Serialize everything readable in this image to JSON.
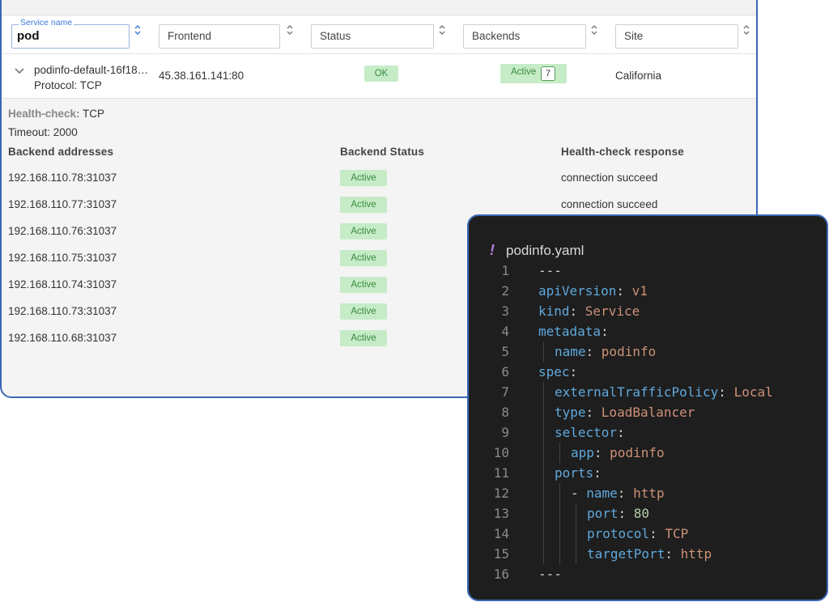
{
  "filters": {
    "service_name_label": "Service name",
    "service_name_value": "pod",
    "frontend_label": "Frontend",
    "status_label": "Status",
    "backends_label": "Backends",
    "site_label": "Site"
  },
  "service_row": {
    "name": "podinfo-default-16f18…",
    "protocol": "Protocol: TCP",
    "frontend": "45.38.161.141:80",
    "status": "OK",
    "backends_label": "Active",
    "backends_count": "7",
    "site": "California"
  },
  "details": {
    "healthcheck_key": "Health-check:",
    "healthcheck_value": "TCP",
    "timeout": "Timeout: 2000",
    "col_addresses": "Backend addresses",
    "col_status": "Backend Status",
    "col_response": "Health-check response",
    "backends": [
      {
        "address": "192.168.110.78:31037",
        "status": "Active",
        "response": "connection succeed"
      },
      {
        "address": "192.168.110.77:31037",
        "status": "Active",
        "response": "connection succeed"
      },
      {
        "address": "192.168.110.76:31037",
        "status": "Active",
        "response": ""
      },
      {
        "address": "192.168.110.75:31037",
        "status": "Active",
        "response": ""
      },
      {
        "address": "192.168.110.74:31037",
        "status": "Active",
        "response": ""
      },
      {
        "address": "192.168.110.73:31037",
        "status": "Active",
        "response": ""
      },
      {
        "address": "192.168.110.68:31037",
        "status": "Active",
        "response": ""
      }
    ]
  },
  "editor": {
    "file_icon": "!",
    "file_name": "podinfo.yaml",
    "lines": [
      {
        "n": "1",
        "indent": 0,
        "key": "",
        "sep": "",
        "value": "---",
        "vtype": "punc"
      },
      {
        "n": "2",
        "indent": 0,
        "key": "apiVersion",
        "sep": ": ",
        "value": "v1",
        "vtype": "val"
      },
      {
        "n": "3",
        "indent": 0,
        "key": "kind",
        "sep": ": ",
        "value": "Service",
        "vtype": "val"
      },
      {
        "n": "4",
        "indent": 0,
        "key": "metadata",
        "sep": ":",
        "value": "",
        "vtype": "val"
      },
      {
        "n": "5",
        "indent": 1,
        "key": "name",
        "sep": ": ",
        "value": "podinfo",
        "vtype": "val"
      },
      {
        "n": "6",
        "indent": 0,
        "key": "spec",
        "sep": ":",
        "value": "",
        "vtype": "val"
      },
      {
        "n": "7",
        "indent": 1,
        "key": "externalTrafficPolicy",
        "sep": ": ",
        "value": "Local",
        "vtype": "val"
      },
      {
        "n": "8",
        "indent": 1,
        "key": "type",
        "sep": ": ",
        "value": "LoadBalancer",
        "vtype": "val"
      },
      {
        "n": "9",
        "indent": 1,
        "key": "selector",
        "sep": ":",
        "value": "",
        "vtype": "val"
      },
      {
        "n": "10",
        "indent": 2,
        "key": "app",
        "sep": ": ",
        "value": "podinfo",
        "vtype": "val"
      },
      {
        "n": "11",
        "indent": 1,
        "key": "ports",
        "sep": ":",
        "value": "",
        "vtype": "val"
      },
      {
        "n": "12",
        "indent": 2,
        "key": "name",
        "sep": ": ",
        "value": "http",
        "vtype": "val",
        "dash": true
      },
      {
        "n": "13",
        "indent": 3,
        "key": "port",
        "sep": ": ",
        "value": "80",
        "vtype": "num"
      },
      {
        "n": "14",
        "indent": 3,
        "key": "protocol",
        "sep": ": ",
        "value": "TCP",
        "vtype": "val"
      },
      {
        "n": "15",
        "indent": 3,
        "key": "targetPort",
        "sep": ": ",
        "value": "http",
        "vtype": "val"
      },
      {
        "n": "16",
        "indent": 0,
        "key": "",
        "sep": "",
        "value": "---",
        "vtype": "punc"
      }
    ]
  }
}
